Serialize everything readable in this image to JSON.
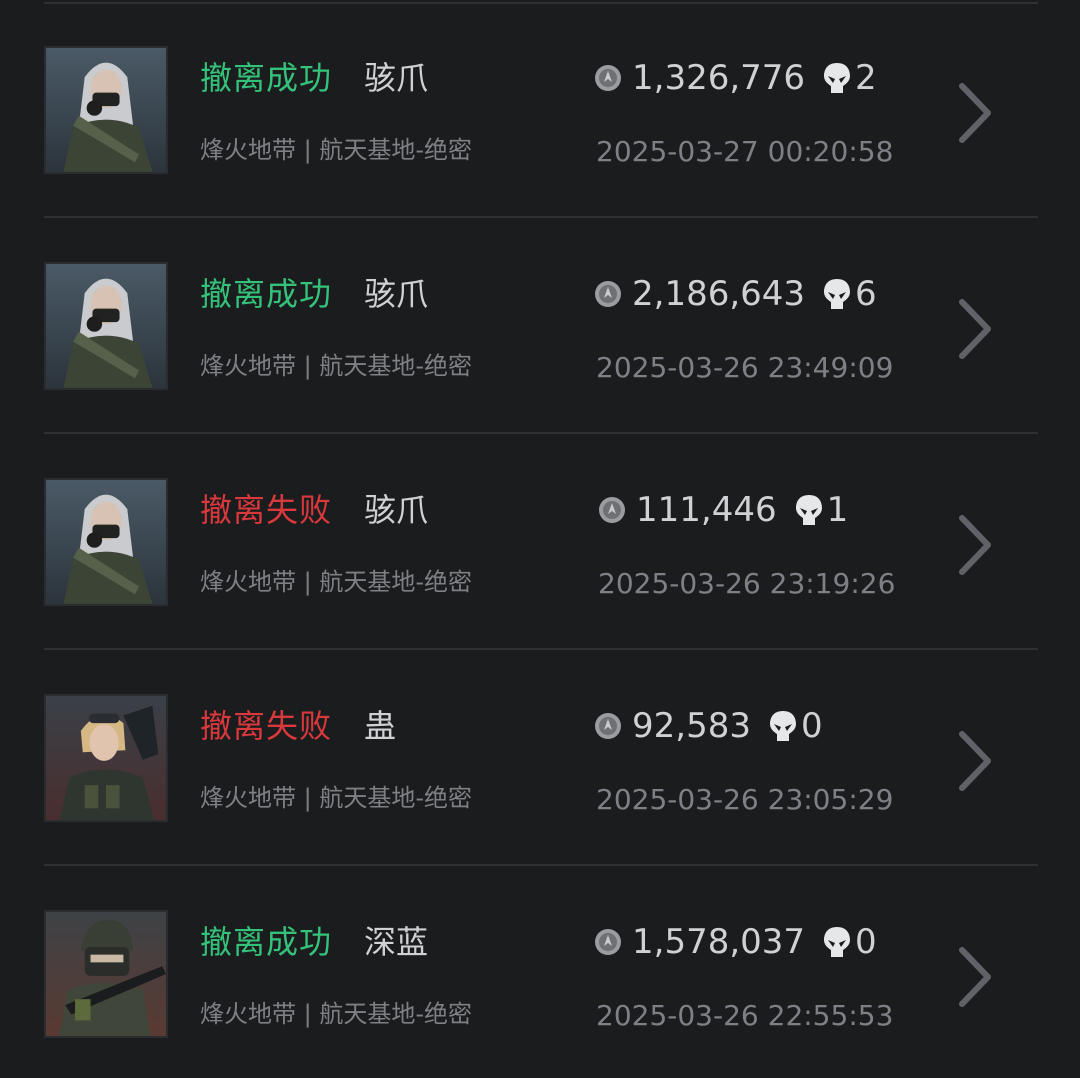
{
  "colors": {
    "success": "#34c27a",
    "failure": "#d9383d",
    "text_primary": "#cfd1d4",
    "text_secondary": "#7d8085",
    "background": "#1b1c1e"
  },
  "records": [
    {
      "status": "撤离成功",
      "status_type": "success",
      "operator": "骇爪",
      "map": "烽火地带 | 航天基地-绝密",
      "value": "1,326,776",
      "kills": "2",
      "time": "2025-03-27 00:20:58",
      "avatar": "female-silver-hair-masked-portrait"
    },
    {
      "status": "撤离成功",
      "status_type": "success",
      "operator": "骇爪",
      "map": "烽火地带 | 航天基地-绝密",
      "value": "2,186,643",
      "kills": "6",
      "time": "2025-03-26 23:49:09",
      "avatar": "female-silver-hair-masked-portrait"
    },
    {
      "status": "撤离失败",
      "status_type": "failure",
      "operator": "骇爪",
      "map": "烽火地带 | 航天基地-绝密",
      "value": "111,446",
      "kills": "1",
      "time": "2025-03-26 23:19:26",
      "avatar": "female-silver-hair-masked-portrait"
    },
    {
      "status": "撤离失败",
      "status_type": "failure",
      "operator": "蛊",
      "map": "烽火地带 | 航天基地-绝密",
      "value": "92,583",
      "kills": "0",
      "time": "2025-03-26 23:05:29",
      "avatar": "female-blonde-goggles-portrait"
    },
    {
      "status": "撤离成功",
      "status_type": "success",
      "operator": "深蓝",
      "map": "烽火地带 | 航天基地-绝密",
      "value": "1,578,037",
      "kills": "0",
      "time": "2025-03-26 22:55:53",
      "avatar": "helmeted-soldier-with-rifle-portrait"
    }
  ]
}
